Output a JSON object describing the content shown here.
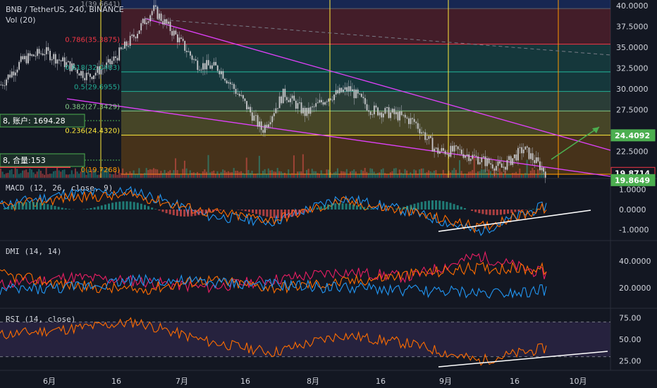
{
  "header": {
    "symbol_line": "BNB / TetherUS, 240, BINANCE",
    "volume_label": "Vol (20)"
  },
  "price_axis": {
    "ticks": [
      "40.0000",
      "37.5000",
      "35.0000",
      "32.5000",
      "30.0000",
      "27.5000",
      "22.5000"
    ],
    "badges": [
      {
        "text": "24.4092",
        "value": 24.4092,
        "color": "#4caf50"
      },
      {
        "text": "19.8714",
        "value": 19.8714,
        "color": "#131722"
      },
      {
        "text": "19.8649",
        "value": 19.8649,
        "color": "#4caf50"
      }
    ]
  },
  "fib_levels": [
    {
      "label": "1(39.6641)",
      "value": 39.6641,
      "fill": "#5d606b"
    },
    {
      "label": "0.786(35.3875)",
      "value": 35.3875,
      "fill": "#f23645"
    },
    {
      "label": "0.618(32.0483)",
      "value": 32.0483,
      "fill": "#22ab94"
    },
    {
      "label": "0.5(29.6955)",
      "value": 29.6955,
      "fill": "#22ab94"
    },
    {
      "label": "0.382(27.3429)",
      "value": 27.3429,
      "fill": "#81c784"
    },
    {
      "label": "0.236(24.4320)",
      "value": 24.432,
      "fill": "#ffeb3b"
    },
    {
      "label": "0(19.7268)",
      "value": 19.7268,
      "fill": "#ff9800"
    }
  ],
  "order_tags": [
    {
      "text": "8, 账户: 1694.28",
      "color": "#4caf50"
    },
    {
      "text": "8, 合量:153",
      "color": "#4caf50"
    }
  ],
  "macd": {
    "label": "MACD (12, 26, close, 9)",
    "ticks": [
      "1.0000",
      "0.0000",
      "-1.0000"
    ]
  },
  "dmi": {
    "label": "DMI (14, 14)",
    "ticks": [
      "40.0000",
      "20.0000"
    ]
  },
  "rsi": {
    "label": "RSI (14, close)",
    "ticks": [
      "75.00",
      "50.00",
      "25.00"
    ]
  },
  "time_axis": {
    "ticks": [
      "6月",
      "16",
      "7月",
      "16",
      "8月",
      "16",
      "9月",
      "16",
      "10月"
    ]
  },
  "chart_data": [
    {
      "type": "line",
      "pane": "price",
      "ylim": [
        19.3,
        40.7
      ],
      "x": [
        "05-22",
        "05-27",
        "06-01",
        "06-06",
        "06-11",
        "06-16",
        "06-21",
        "06-26",
        "07-01",
        "07-06",
        "07-11",
        "07-16",
        "07-21",
        "07-26",
        "07-31",
        "08-05",
        "08-10",
        "08-15",
        "08-20",
        "08-25",
        "08-30",
        "09-04",
        "09-09",
        "09-14",
        "09-19",
        "09-24"
      ],
      "series": [
        {
          "values": [
            30.5,
            33.5,
            34.5,
            33,
            31.5,
            33,
            36,
            39.6,
            36.5,
            33,
            32.5,
            29,
            25,
            29.5,
            27,
            29,
            30,
            27.5,
            27,
            26,
            22.5,
            22.5,
            21.5,
            20.5,
            22.8,
            20
          ]
        }
      ]
    },
    {
      "type": "line",
      "pane": "macd",
      "ylim": [
        -1.5,
        1.5
      ],
      "x": [
        "05-22",
        "06-06",
        "06-21",
        "07-06",
        "07-21",
        "08-05",
        "08-20",
        "09-04",
        "09-19"
      ],
      "series": [
        {
          "values": [
            0.2,
            0.8,
            0.9,
            -0.3,
            -0.6,
            0.6,
            -0.1,
            -1.1,
            0.2
          ]
        },
        {
          "values": [
            0.1,
            0.6,
            0.7,
            -0.1,
            -0.5,
            0.4,
            -0.1,
            -0.9,
            0.1
          ]
        }
      ]
    },
    {
      "type": "line",
      "pane": "dmi",
      "ylim": [
        5,
        55
      ],
      "x": [
        "05-22",
        "06-06",
        "06-21",
        "07-06",
        "07-21",
        "08-05",
        "08-20",
        "09-04",
        "09-19"
      ],
      "series": [
        {
          "values": [
            22,
            28,
            25,
            20,
            26,
            32,
            28,
            44,
            30
          ]
        },
        {
          "values": [
            30,
            22,
            18,
            26,
            20,
            24,
            30,
            35,
            34
          ]
        },
        {
          "values": [
            18,
            20,
            26,
            24,
            22,
            20,
            18,
            16,
            18
          ]
        }
      ]
    },
    {
      "type": "line",
      "pane": "rsi",
      "ylim": [
        15,
        85
      ],
      "x": [
        "05-22",
        "06-06",
        "06-21",
        "07-06",
        "07-21",
        "08-05",
        "08-20",
        "09-04",
        "09-19"
      ],
      "series": [
        {
          "values": [
            55,
            62,
            70,
            48,
            35,
            55,
            45,
            25,
            40
          ]
        }
      ]
    }
  ]
}
